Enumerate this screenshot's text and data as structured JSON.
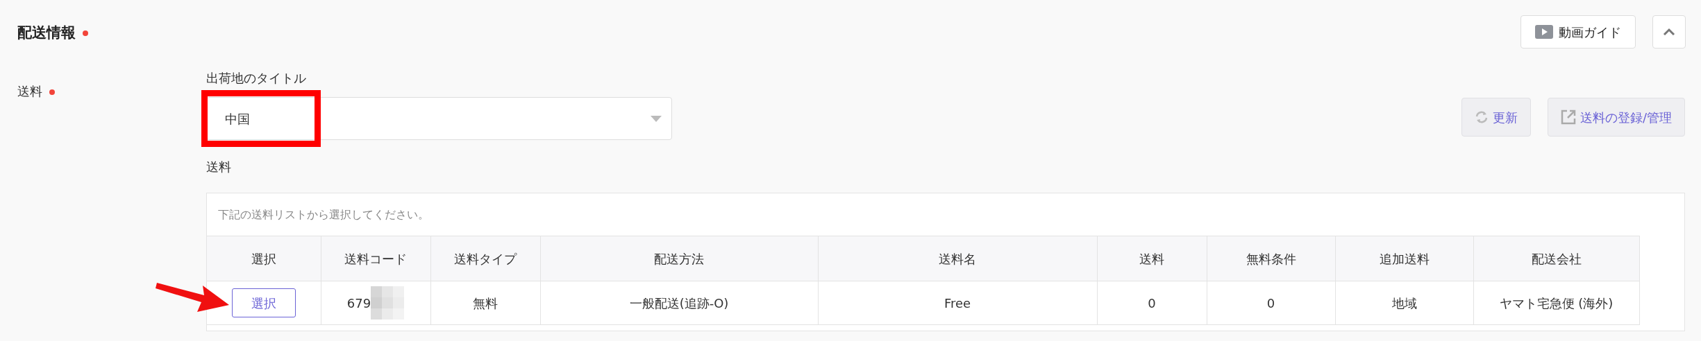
{
  "section": {
    "title": "配送情報",
    "required": true
  },
  "header_buttons": [
    {
      "kind": "video",
      "label": "動画ガイド"
    },
    {
      "kind": "collapse"
    }
  ],
  "field": {
    "label": "送料",
    "required": true
  },
  "origin": {
    "label": "出荷地のタイトル",
    "value": "中国"
  },
  "actions": [
    {
      "kind": "refresh",
      "label": "更新"
    },
    {
      "kind": "external",
      "label": "送料の登録/管理"
    }
  ],
  "shipping": {
    "label": "送料",
    "hint": "下記の送料リストから選択してください。",
    "columns": [
      "選択",
      "送料コード",
      "送料タイプ",
      "配送方法",
      "送料名",
      "送料",
      "無料条件",
      "追加送料",
      "配送会社"
    ],
    "rows": [
      {
        "cells": [
          "選択",
          "679",
          "無料",
          "一般配送(追跡-O)",
          "Free",
          "0",
          "0",
          "地域",
          "ヤマト宅急便 (海外)"
        ]
      }
    ]
  }
}
